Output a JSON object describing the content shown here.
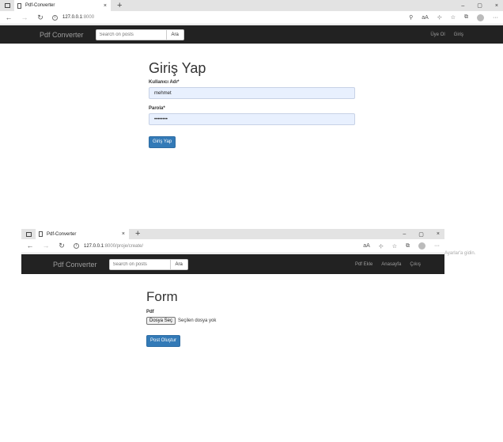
{
  "screen1": {
    "tab_title": "Pdf-Converter",
    "tab_close": "×",
    "new_tab": "+",
    "window_controls": [
      "–",
      "▢",
      "×"
    ],
    "url_host": "127.0.0.1",
    "url_path": ":8000",
    "nav": {
      "brand": "Pdf Converter",
      "search_placeholder": "Search on posts",
      "search_button": "Ara",
      "links": [
        "Üye Ol",
        "Giriş"
      ]
    },
    "page": {
      "title": "Giriş Yap",
      "username_label": "Kullanıcı Adı*",
      "username_value": "mehmet",
      "password_label": "Parola*",
      "password_value": "••••••••",
      "submit_label": "Giriş Yap"
    }
  },
  "screen2": {
    "tab_title": "Pdf-Converter",
    "tab_close": "×",
    "new_tab": "+",
    "window_controls": [
      "–",
      "▢",
      "×"
    ],
    "url_host": "127.0.0.1",
    "url_path": ":8000/proje/create/",
    "nav": {
      "brand": "Pdf Converter",
      "search_placeholder": "Search on posts",
      "search_button": "Ara",
      "links": [
        "Pdf Ekle",
        "Anasayfa",
        "Çıkış"
      ]
    },
    "page": {
      "title": "Form",
      "pdf_label": "Pdf",
      "file_button": "Dosya Seç",
      "file_status": "Seçilen dosya yok",
      "submit_label": "Post Oluştur"
    }
  },
  "overflow_text": "Ayarlar'a gidin.",
  "colors": {
    "navbar_bg": "#222222",
    "navbar_text": "#9d9d9d",
    "primary_button": "#337ab7",
    "autofill_bg": "#e8f0fe"
  }
}
